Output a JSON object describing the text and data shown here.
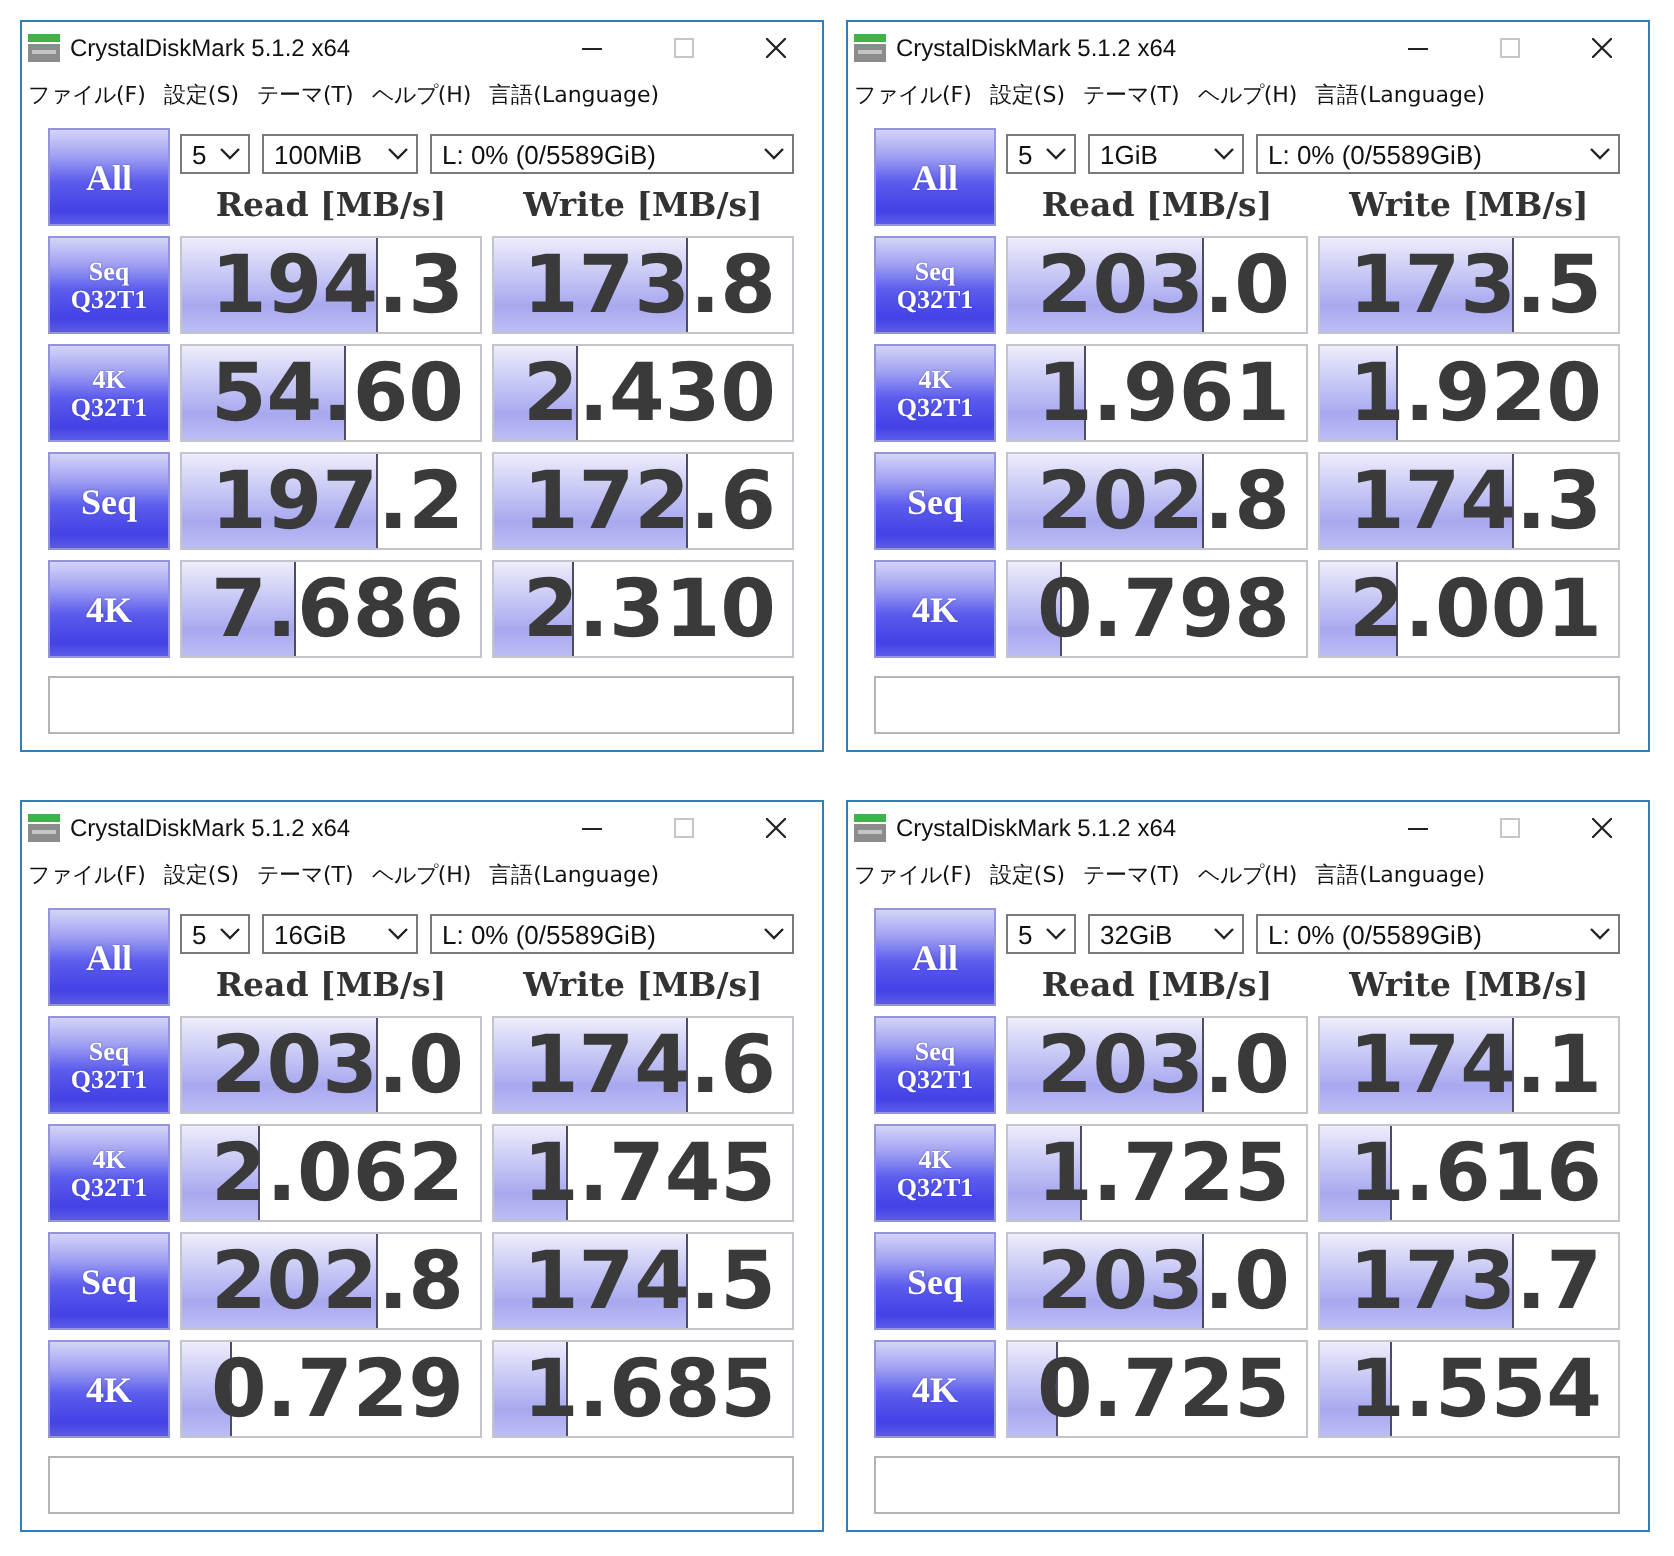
{
  "windows": [
    {
      "title": "CrystalDiskMark 5.1.2 x64",
      "maximize_disabled": true,
      "menu": [
        "ファイル(F)",
        "設定(S)",
        "テーマ(T)",
        "ヘルプ(H)",
        "言語(Language)"
      ],
      "all_button": "All",
      "count": "5",
      "size": "100MiB",
      "drive": "L: 0% (0/5589GiB)",
      "headers": [
        "Read [MB/s]",
        "Write [MB/s]"
      ],
      "rows": [
        {
          "label": "Seq",
          "sublabel": "Q32T1",
          "results": [
            {
              "value": "194.3",
              "level": 0.66
            },
            {
              "value": "173.8",
              "level": 0.65
            }
          ]
        },
        {
          "label": "4K",
          "sublabel": "Q32T1",
          "results": [
            {
              "value": "54.60",
              "level": 0.55
            },
            {
              "value": "2.430",
              "level": 0.28
            }
          ]
        },
        {
          "label": "Seq",
          "results": [
            {
              "value": "197.2",
              "level": 0.66
            },
            {
              "value": "172.6",
              "level": 0.65
            }
          ]
        },
        {
          "label": "4K",
          "results": [
            {
              "value": "7.686",
              "level": 0.38
            },
            {
              "value": "2.310",
              "level": 0.27
            }
          ]
        }
      ]
    },
    {
      "title": "CrystalDiskMark 5.1.2 x64",
      "maximize_disabled": true,
      "menu": [
        "ファイル(F)",
        "設定(S)",
        "テーマ(T)",
        "ヘルプ(H)",
        "言語(Language)"
      ],
      "all_button": "All",
      "count": "5",
      "size": "1GiB",
      "drive": "L: 0% (0/5589GiB)",
      "headers": [
        "Read [MB/s]",
        "Write [MB/s]"
      ],
      "rows": [
        {
          "label": "Seq",
          "sublabel": "Q32T1",
          "results": [
            {
              "value": "203.0",
              "level": 0.66
            },
            {
              "value": "173.5",
              "level": 0.65
            }
          ]
        },
        {
          "label": "4K",
          "sublabel": "Q32T1",
          "results": [
            {
              "value": "1.961",
              "level": 0.26
            },
            {
              "value": "1.920",
              "level": 0.26
            }
          ]
        },
        {
          "label": "Seq",
          "results": [
            {
              "value": "202.8",
              "level": 0.66
            },
            {
              "value": "174.3",
              "level": 0.65
            }
          ]
        },
        {
          "label": "4K",
          "results": [
            {
              "value": "0.798",
              "level": 0.18
            },
            {
              "value": "2.001",
              "level": 0.26
            }
          ]
        }
      ]
    },
    {
      "title": "CrystalDiskMark 5.1.2 x64",
      "maximize_disabled": true,
      "menu": [
        "ファイル(F)",
        "設定(S)",
        "テーマ(T)",
        "ヘルプ(H)",
        "言語(Language)"
      ],
      "all_button": "All",
      "count": "5",
      "size": "16GiB",
      "drive": "L: 0% (0/5589GiB)",
      "headers": [
        "Read [MB/s]",
        "Write [MB/s]"
      ],
      "rows": [
        {
          "label": "Seq",
          "sublabel": "Q32T1",
          "results": [
            {
              "value": "203.0",
              "level": 0.66
            },
            {
              "value": "174.6",
              "level": 0.65
            }
          ]
        },
        {
          "label": "4K",
          "sublabel": "Q32T1",
          "results": [
            {
              "value": "2.062",
              "level": 0.26
            },
            {
              "value": "1.745",
              "level": 0.25
            }
          ]
        },
        {
          "label": "Seq",
          "results": [
            {
              "value": "202.8",
              "level": 0.66
            },
            {
              "value": "174.5",
              "level": 0.65
            }
          ]
        },
        {
          "label": "4K",
          "results": [
            {
              "value": "0.729",
              "level": 0.17
            },
            {
              "value": "1.685",
              "level": 0.25
            }
          ]
        }
      ]
    },
    {
      "title": "CrystalDiskMark 5.1.2 x64",
      "maximize_disabled": true,
      "menu": [
        "ファイル(F)",
        "設定(S)",
        "テーマ(T)",
        "ヘルプ(H)",
        "言語(Language)"
      ],
      "all_button": "All",
      "count": "5",
      "size": "32GiB",
      "drive": "L: 0% (0/5589GiB)",
      "headers": [
        "Read [MB/s]",
        "Write [MB/s]"
      ],
      "rows": [
        {
          "label": "Seq",
          "sublabel": "Q32T1",
          "results": [
            {
              "value": "203.0",
              "level": 0.66
            },
            {
              "value": "174.1",
              "level": 0.65
            }
          ]
        },
        {
          "label": "4K",
          "sublabel": "Q32T1",
          "results": [
            {
              "value": "1.725",
              "level": 0.25
            },
            {
              "value": "1.616",
              "level": 0.24
            }
          ]
        },
        {
          "label": "Seq",
          "results": [
            {
              "value": "203.0",
              "level": 0.66
            },
            {
              "value": "173.7",
              "level": 0.65
            }
          ]
        },
        {
          "label": "4K",
          "results": [
            {
              "value": "0.725",
              "level": 0.17
            },
            {
              "value": "1.554",
              "level": 0.24
            }
          ]
        }
      ]
    }
  ]
}
